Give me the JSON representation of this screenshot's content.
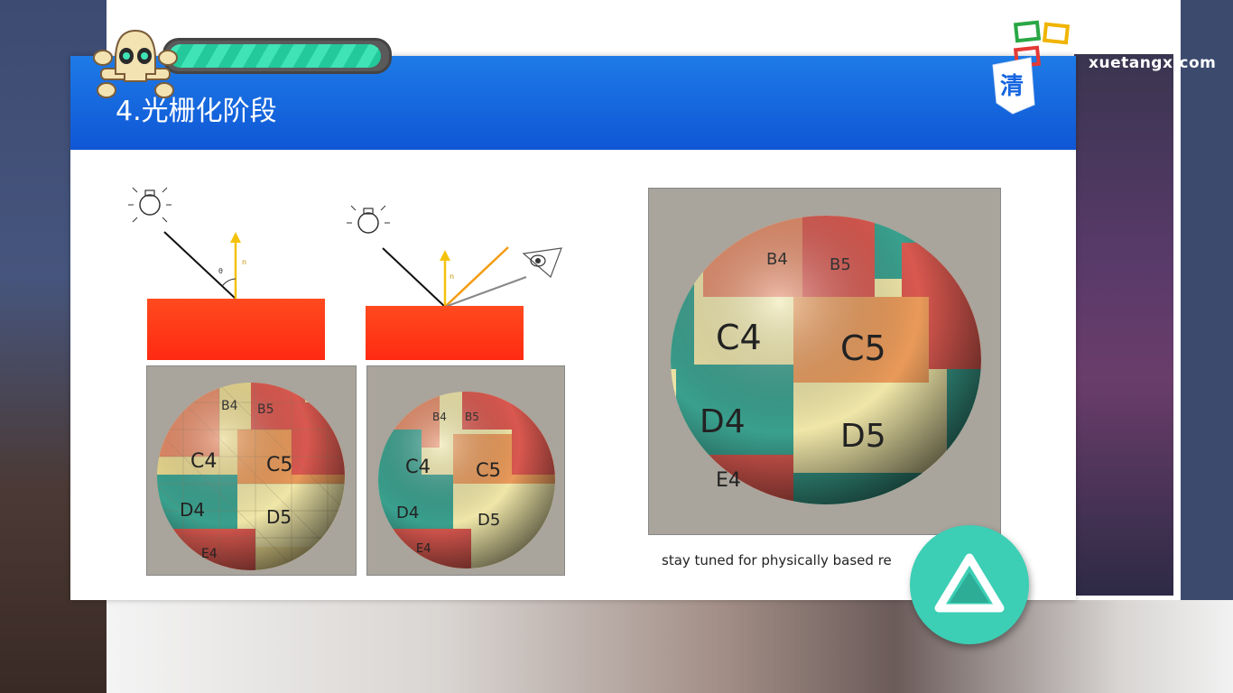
{
  "slide": {
    "title": "4.光栅化阶段",
    "caption": "stay tuned for physically based re"
  },
  "brand": {
    "site": "xuetangx.com"
  },
  "spheres": {
    "small_left": [
      "B4",
      "B5",
      "C4",
      "C5",
      "D4",
      "D5",
      "E4"
    ],
    "small_right": [
      "B4",
      "B5",
      "C4",
      "C5",
      "D4",
      "D5",
      "E4"
    ],
    "large": [
      "B4",
      "B5",
      "C4",
      "C5",
      "D4",
      "D5",
      "E4"
    ]
  },
  "diagram_labels": {
    "normal": "n",
    "angle": "θ"
  },
  "colors": {
    "header_blue": "#1565e0",
    "accent_teal": "#3ccfb5",
    "tile_red": "#d9584f",
    "tile_yellow": "#efe6a8",
    "tile_teal": "#3aa08e",
    "tile_orange": "#e99a5a"
  },
  "icons": {
    "play": "triangle-play-icon",
    "skull": "skull-icon",
    "bulb": "light-bulb-icon",
    "eye": "eye-icon"
  },
  "progress": {
    "health_fraction": 0.98
  }
}
